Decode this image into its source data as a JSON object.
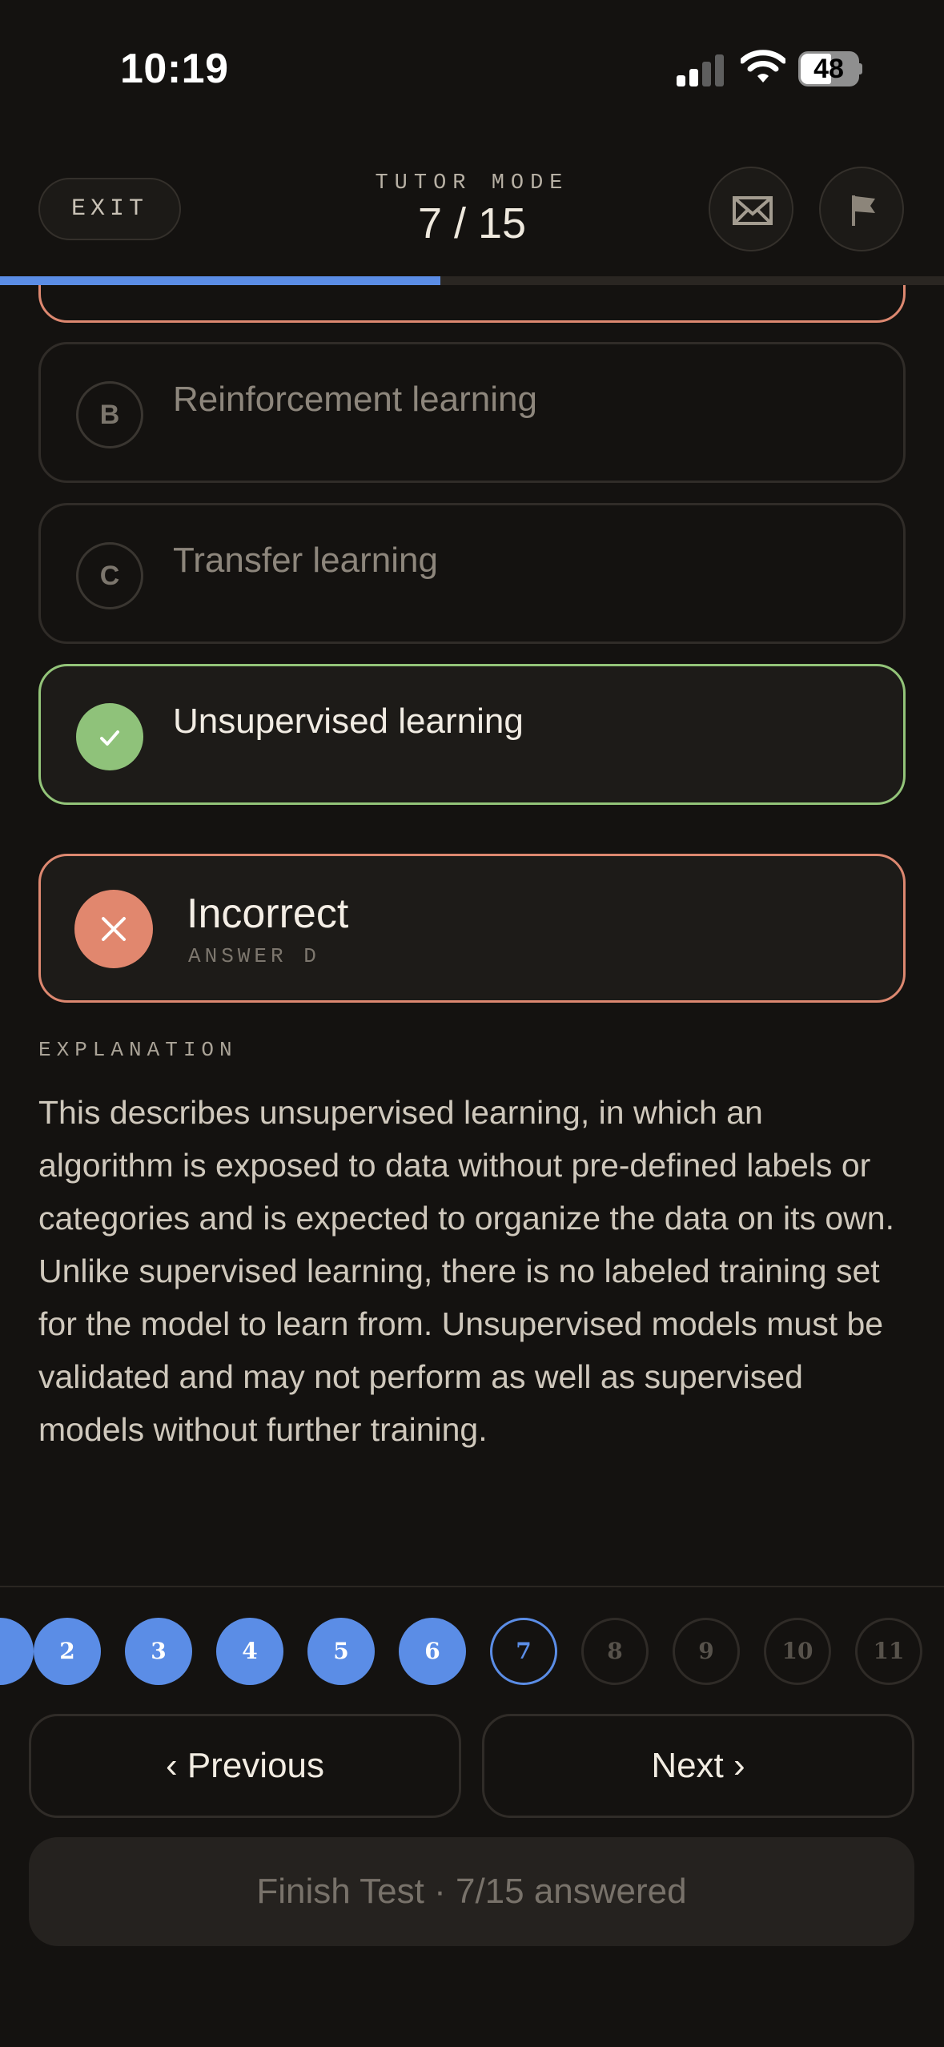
{
  "status_bar": {
    "time": "10:19",
    "battery": "48"
  },
  "header": {
    "exit_label": "EXIT",
    "mode_label": "TUTOR MODE",
    "progress": "7 / 15",
    "progress_fraction": 0.4667,
    "accent_color": "#5b8de6"
  },
  "options": [
    {
      "letter": "B",
      "text": "Reinforcement learning",
      "state": "default"
    },
    {
      "letter": "C",
      "text": "Transfer learning",
      "state": "default"
    },
    {
      "letter": "D",
      "text": "Unsupervised learning",
      "state": "correct",
      "icon": "check-icon"
    }
  ],
  "result": {
    "title": "Incorrect",
    "subtitle": "ANSWER D",
    "icon": "close-icon",
    "color": "#e1876e"
  },
  "explanation": {
    "label": "EXPLANATION",
    "text": "This describes unsupervised learning, in which an algorithm is exposed to data without pre-defined labels or categories and is expected to organize the data on its own. Unlike supervised learning, there is no labeled training set for the model to learn from. Unsupervised models must be validated and may not perform as well as supervised models without further training."
  },
  "question_nav": {
    "answered": [
      "2",
      "3",
      "4",
      "5",
      "6"
    ],
    "current": "7",
    "pending": [
      "8",
      "9",
      "10",
      "11"
    ]
  },
  "buttons": {
    "previous": "‹ Previous",
    "next": "Next ›",
    "finish": "Finish Test · 7/15 answered"
  }
}
